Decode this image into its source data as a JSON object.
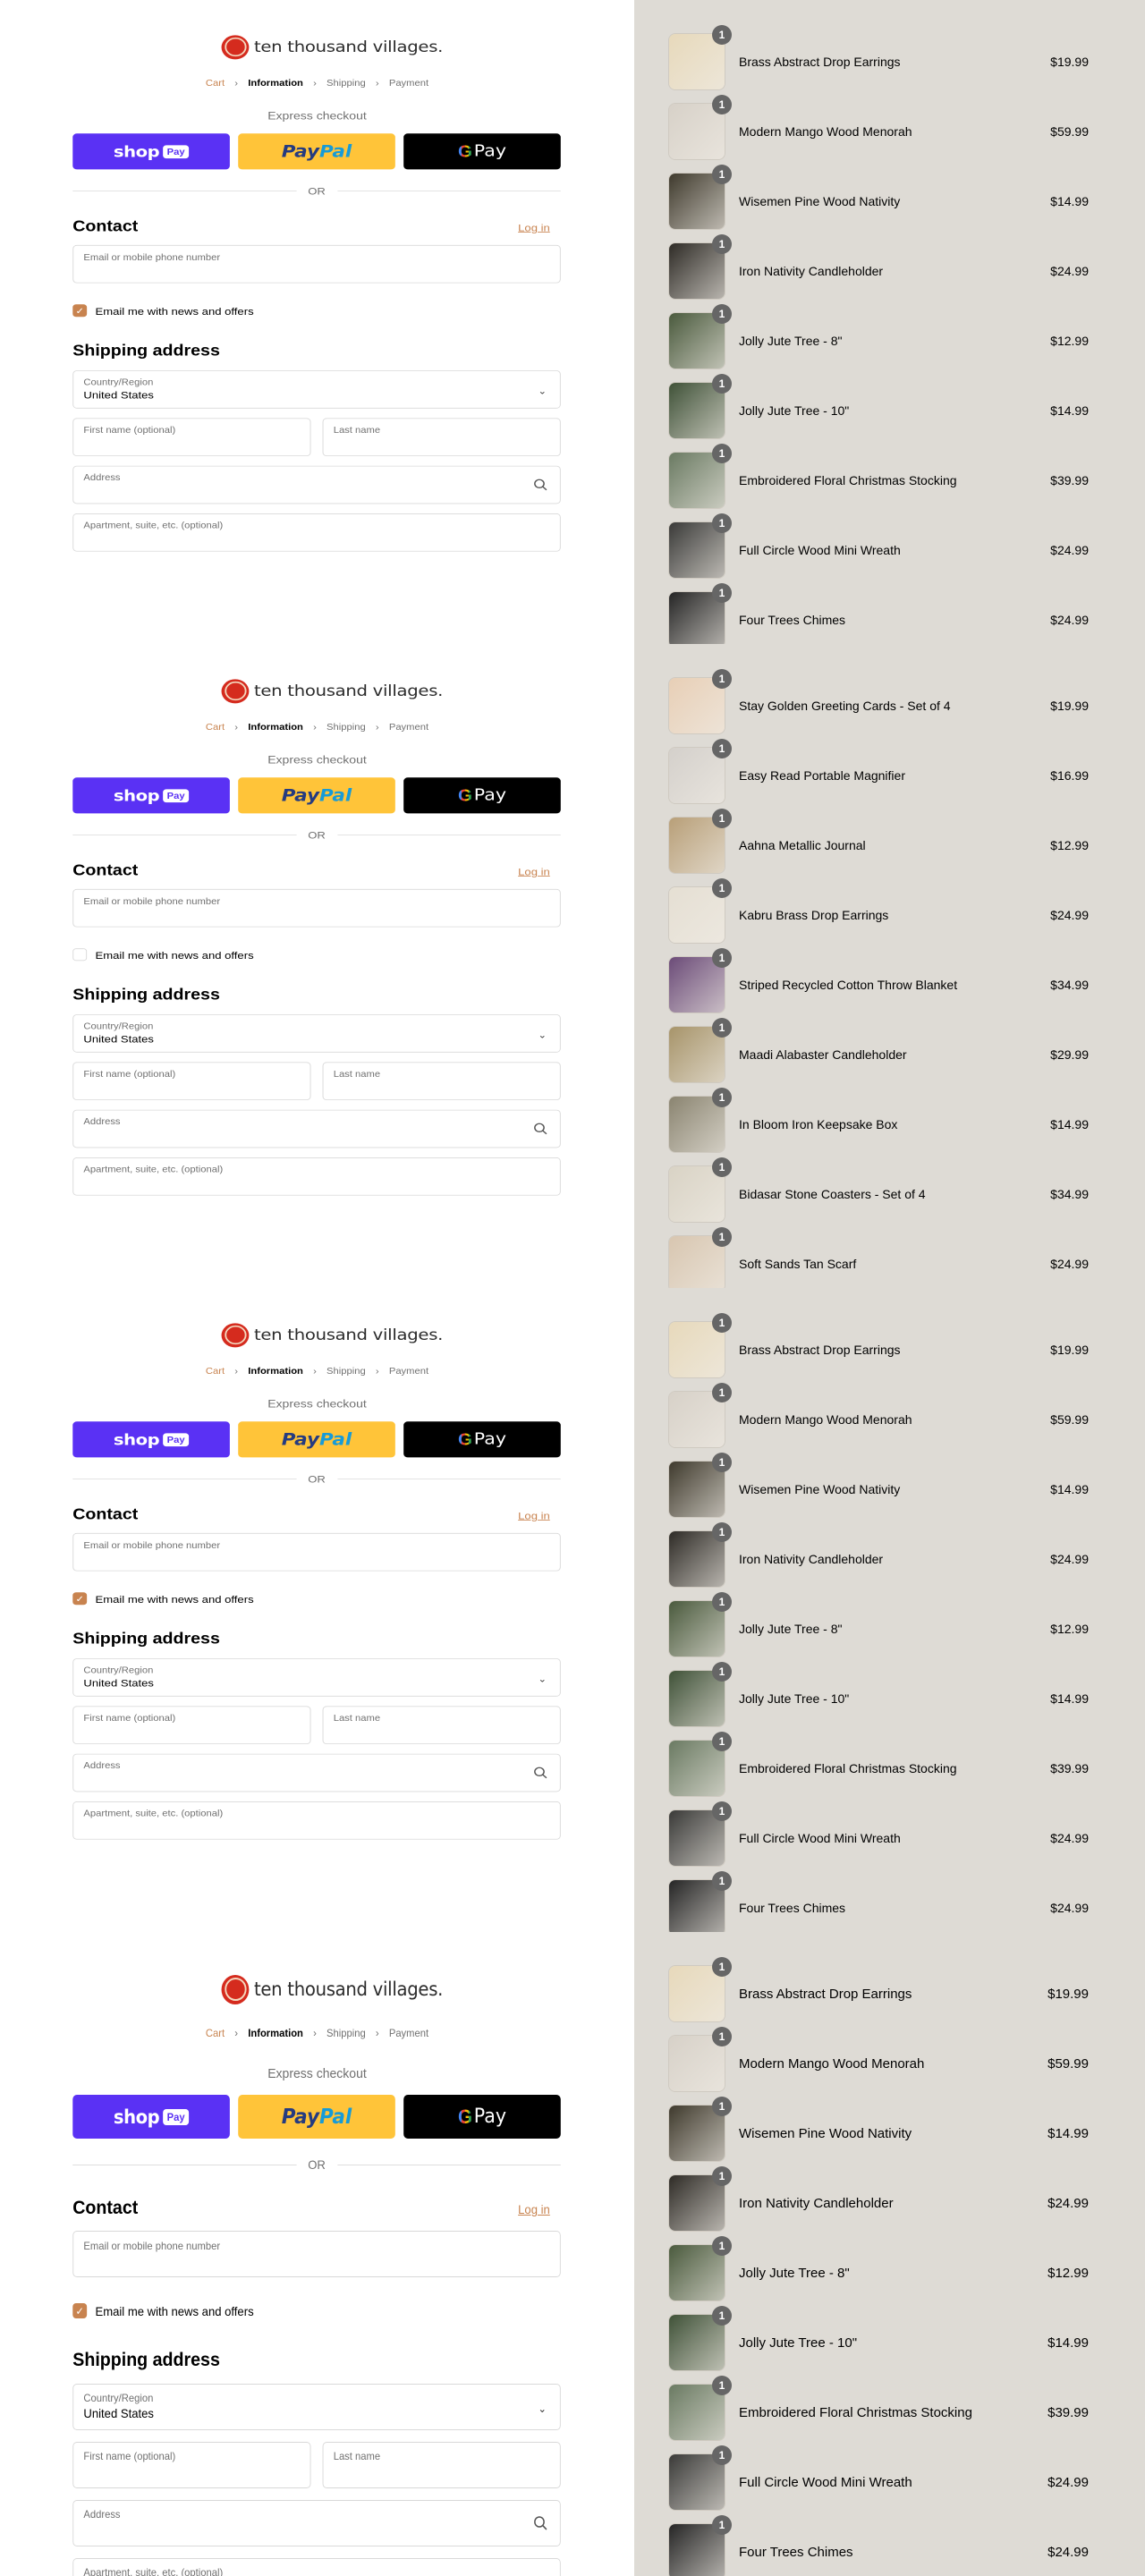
{
  "brand": {
    "name": "ten thousand villages.",
    "accent": "#c8834f",
    "logo_red": "#d52b1e",
    "sidebar_bg": "#dedbd5"
  },
  "breadcrumb": [
    {
      "label": "Cart",
      "state": "link"
    },
    {
      "label": "Information",
      "state": "current"
    },
    {
      "label": "Shipping",
      "state": "future"
    },
    {
      "label": "Payment",
      "state": "future"
    }
  ],
  "express": {
    "title": "Express checkout",
    "shop": {
      "word": "shop",
      "badge": "Pay",
      "color": "#5a31f4"
    },
    "paypal": {
      "a": "Pay",
      "b": "Pal",
      "color": "#ffc439"
    },
    "gpay": {
      "g": "G",
      "word": "Pay",
      "color": "#000000"
    },
    "or": "OR"
  },
  "contact": {
    "heading": "Contact",
    "login": "Log in",
    "email_placeholder": "Email or mobile phone number",
    "newsletter": "Email me with news and offers"
  },
  "shipping": {
    "heading": "Shipping address",
    "country_label": "Country/Region",
    "country_value": "United States",
    "first_name": "First name (optional)",
    "last_name": "Last name",
    "address": "Address",
    "apartment": "Apartment, suite, etc. (optional)"
  },
  "panels": [
    {
      "newsletter_checked": true,
      "cart": [
        {
          "name": "Brass Abstract Drop Earrings",
          "price": "$19.99",
          "qty": "1",
          "color": "#e7d9bb"
        },
        {
          "name": "Modern Mango Wood Menorah",
          "price": "$59.99",
          "qty": "1",
          "color": "#d7d1c8"
        },
        {
          "name": "Wisemen Pine Wood Nativity",
          "price": "$14.99",
          "qty": "1",
          "color": "#3f3a2d"
        },
        {
          "name": "Iron Nativity Candleholder",
          "price": "$24.99",
          "qty": "1",
          "color": "#2e2b26"
        },
        {
          "name": "Jolly Jute Tree - 8\"",
          "price": "$12.99",
          "qty": "1",
          "color": "#4a5a3d"
        },
        {
          "name": "Jolly Jute Tree - 10\"",
          "price": "$14.99",
          "qty": "1",
          "color": "#405238"
        },
        {
          "name": "Embroidered Floral Christmas Stocking",
          "price": "$39.99",
          "qty": "1",
          "color": "#6a7a62"
        },
        {
          "name": "Full Circle Wood Mini Wreath",
          "price": "$24.99",
          "qty": "1",
          "color": "#3a3a38"
        },
        {
          "name": "Four Trees Chimes",
          "price": "$24.99",
          "qty": "1",
          "color": "#252525"
        }
      ]
    },
    {
      "newsletter_checked": false,
      "cart": [
        {
          "name": "Stay Golden Greeting Cards - Set of 4",
          "price": "$19.99",
          "qty": "1",
          "color": "#e8cfb6"
        },
        {
          "name": "Easy Read Portable Magnifier",
          "price": "$16.99",
          "qty": "1",
          "color": "#d4d0cb"
        },
        {
          "name": "Aahna Metallic Journal",
          "price": "$12.99",
          "qty": "1",
          "color": "#b89f78"
        },
        {
          "name": "Kabru Brass Drop Earrings",
          "price": "$24.99",
          "qty": "1",
          "color": "#e5dfd3"
        },
        {
          "name": "Striped Recycled Cotton Throw Blanket",
          "price": "$34.99",
          "qty": "1",
          "color": "#6b4b78"
        },
        {
          "name": "Maadi Alabaster Candleholder",
          "price": "$29.99",
          "qty": "1",
          "color": "#a7946a"
        },
        {
          "name": "In Bloom Iron Keepsake Box",
          "price": "$14.99",
          "qty": "1",
          "color": "#8a8470"
        },
        {
          "name": "Bidasar Stone Coasters - Set of 4",
          "price": "$34.99",
          "qty": "1",
          "color": "#d9d3c5"
        },
        {
          "name": "Soft Sands Tan Scarf",
          "price": "$24.99",
          "qty": "1",
          "color": "#d8c6b0"
        }
      ]
    },
    {
      "newsletter_checked": true,
      "cart": [
        {
          "name": "Brass Abstract Drop Earrings",
          "price": "$19.99",
          "qty": "1",
          "color": "#e7d9bb"
        },
        {
          "name": "Modern Mango Wood Menorah",
          "price": "$59.99",
          "qty": "1",
          "color": "#d7d1c8"
        },
        {
          "name": "Wisemen Pine Wood Nativity",
          "price": "$14.99",
          "qty": "1",
          "color": "#3f3a2d"
        },
        {
          "name": "Iron Nativity Candleholder",
          "price": "$24.99",
          "qty": "1",
          "color": "#2e2b26"
        },
        {
          "name": "Jolly Jute Tree - 8\"",
          "price": "$12.99",
          "qty": "1",
          "color": "#4a5a3d"
        },
        {
          "name": "Jolly Jute Tree - 10\"",
          "price": "$14.99",
          "qty": "1",
          "color": "#405238"
        },
        {
          "name": "Embroidered Floral Christmas Stocking",
          "price": "$39.99",
          "qty": "1",
          "color": "#6a7a62"
        },
        {
          "name": "Full Circle Wood Mini Wreath",
          "price": "$24.99",
          "qty": "1",
          "color": "#3a3a38"
        },
        {
          "name": "Four Trees Chimes",
          "price": "$24.99",
          "qty": "1",
          "color": "#252525"
        }
      ]
    },
    {
      "newsletter_checked": true,
      "cart": [
        {
          "name": "Brass Abstract Drop Earrings",
          "price": "$19.99",
          "qty": "1",
          "color": "#e7d9bb"
        },
        {
          "name": "Modern Mango Wood Menorah",
          "price": "$59.99",
          "qty": "1",
          "color": "#d7d1c8"
        },
        {
          "name": "Wisemen Pine Wood Nativity",
          "price": "$14.99",
          "qty": "1",
          "color": "#3f3a2d"
        },
        {
          "name": "Iron Nativity Candleholder",
          "price": "$24.99",
          "qty": "1",
          "color": "#2e2b26"
        },
        {
          "name": "Jolly Jute Tree - 8\"",
          "price": "$12.99",
          "qty": "1",
          "color": "#4a5a3d"
        },
        {
          "name": "Jolly Jute Tree - 10\"",
          "price": "$14.99",
          "qty": "1",
          "color": "#405238"
        },
        {
          "name": "Embroidered Floral Christmas Stocking",
          "price": "$39.99",
          "qty": "1",
          "color": "#6a7a62"
        },
        {
          "name": "Full Circle Wood Mini Wreath",
          "price": "$24.99",
          "qty": "1",
          "color": "#3a3a38"
        },
        {
          "name": "Four Trees Chimes",
          "price": "$24.99",
          "qty": "1",
          "color": "#252525"
        }
      ]
    }
  ]
}
